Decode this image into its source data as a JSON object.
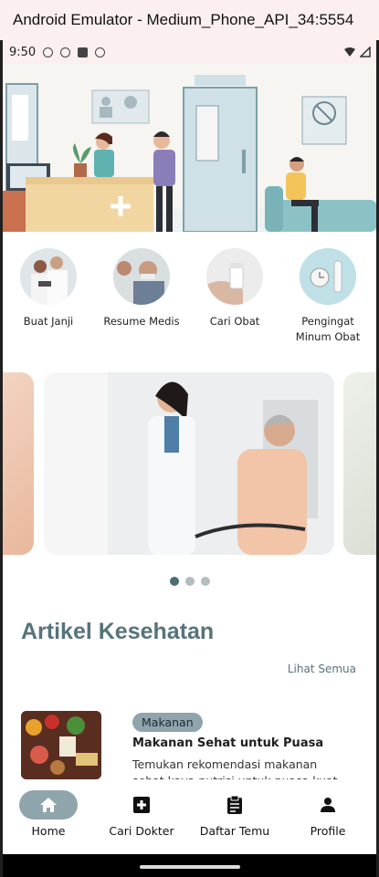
{
  "window": {
    "title": "Android Emulator - Medium_Phone_API_34:5554"
  },
  "status_bar": {
    "time": "9:50"
  },
  "menu": [
    {
      "label": "Buat Janji",
      "icon": "doctors-photo"
    },
    {
      "label": "Resume Medis",
      "icon": "patient-photo"
    },
    {
      "label": "Cari Obat",
      "icon": "medicine-bottle-photo"
    },
    {
      "label": "Pengingat Minum Obat",
      "icon": "alarm-clock-photo"
    }
  ],
  "carousel": {
    "slide_count": 3,
    "active_index": 0
  },
  "articles_section": {
    "title": "Artikel Kesehatan",
    "see_all": "Lihat Semua"
  },
  "articles": [
    {
      "tag": "Makanan",
      "title": "Makanan Sehat untuk Puasa",
      "description": "Temukan rekomendasi makanan sehat kaya nutrisi untuk puasa kuat"
    }
  ],
  "bottom_nav": [
    {
      "label": "Home",
      "icon": "home-icon",
      "active": true
    },
    {
      "label": "Cari Dokter",
      "icon": "medical-plus-icon",
      "active": false
    },
    {
      "label": "Daftar Temu",
      "icon": "clipboard-icon",
      "active": false
    },
    {
      "label": "Profile",
      "icon": "person-icon",
      "active": false
    }
  ],
  "colors": {
    "primary": "#57737c",
    "accent": "#8ea5ac",
    "status_bar": "#fbf0ef"
  }
}
